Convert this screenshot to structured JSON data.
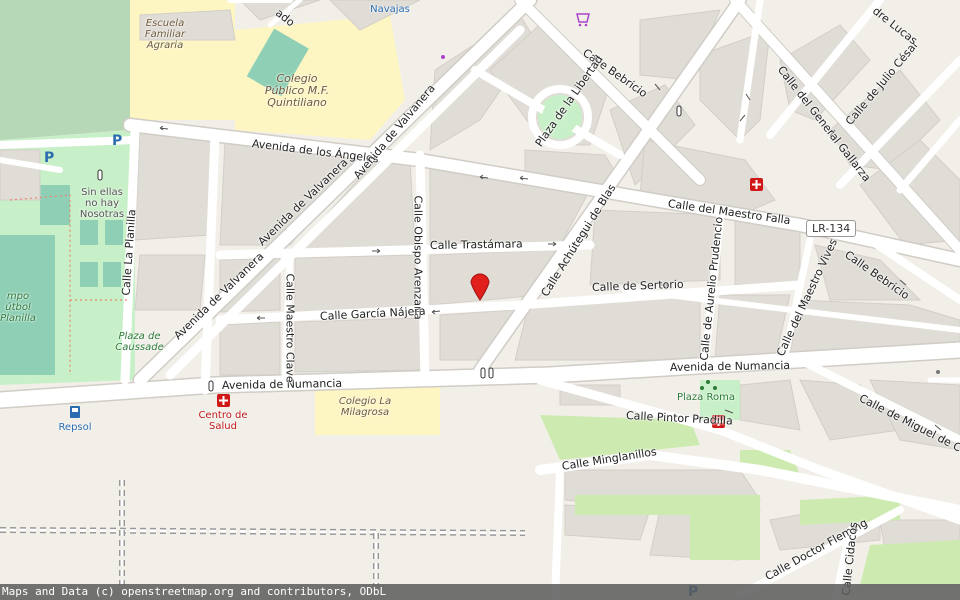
{
  "streets": {
    "avenida_los_angeles": "Avenida de los Ángeles",
    "avenida_valvanera_1": "Avenida de Valvanera",
    "avenida_valvanera_2": "Avenida de Valvanera",
    "avenida_valvanera_3": "Avenida de Valvanera",
    "calle_obispo_arenzana": "Calle Obispo Arenzana",
    "calle_trastamara": "Calle Trastámara",
    "calle_garcia_najera": "Calle García Nájera",
    "calle_sertorio": "Calle de Sertorio",
    "calle_achutegui": "Calle Achútegui de Blas",
    "calle_maestro_falla": "Calle del Maestro Falla",
    "calle_bebricio_1": "Calle Bebricio",
    "calle_bebricio_2": "Calle Bebricio",
    "calle_general_gallarza": "Calle del General Gallarza",
    "calle_julio_cesar": "Calle de Julio César",
    "calle_padre_lucas": "dre Lucas",
    "plaza_libertad": "Plaza de la Libertad",
    "calle_aurelio_prudencio": "Calle de Aurelio Prudencio",
    "calle_maestro_vives": "Calle del Maestro Vives",
    "avenida_numancia_1": "Avenida de Numancia",
    "avenida_numancia_2": "Avenida de Numancia",
    "calle_miguel_cervantes": "Calle de Miguel de Ce",
    "calle_pintor_pradilla": "Calle Pintor Pradilla",
    "calle_minglanillos": "Calle Minglanillos",
    "calle_doctor_fleming": "Calle Doctor Fleming",
    "calle_cidacos": "Calle Cidacos",
    "calle_la_planilla": "Calle La Planilla",
    "calle_maestro_clave": "Calle Maestro Clave",
    "calle_top": "ado"
  },
  "pois": {
    "escuela": "Escuela Familiar Agraria",
    "colegio_quintiliano": "Colegio Público M.F. Quintiliano",
    "sin_ellas": "Sin ellas no hay Nosotras",
    "plaza_caussade": "Plaza de Caussade",
    "campo": "mpo útbol Planilla",
    "repsol": "Repsol",
    "centro_salud": "Centro de Salud",
    "colegio_milagrosa": "Colegio La Milagrosa",
    "plaza_roma": "Plaza Roma",
    "navajas": "Navajas"
  },
  "road_ref": "LR-134",
  "attribution": "Maps and Data (c) openstreetmap.org and contributors, ODbL",
  "parking_label": "P",
  "colors": {
    "background": "#f2efe9",
    "block": "#e0dcd6",
    "road": "#ffffff",
    "school": "#fdf6c3",
    "park": "#c8f0c8",
    "marker": "#e0201c"
  },
  "icons": [
    "map-pin-icon",
    "hospital-icon",
    "fuel-icon",
    "shop-icon",
    "parking-icon",
    "traffic-signal-icon",
    "playground-icon"
  ]
}
